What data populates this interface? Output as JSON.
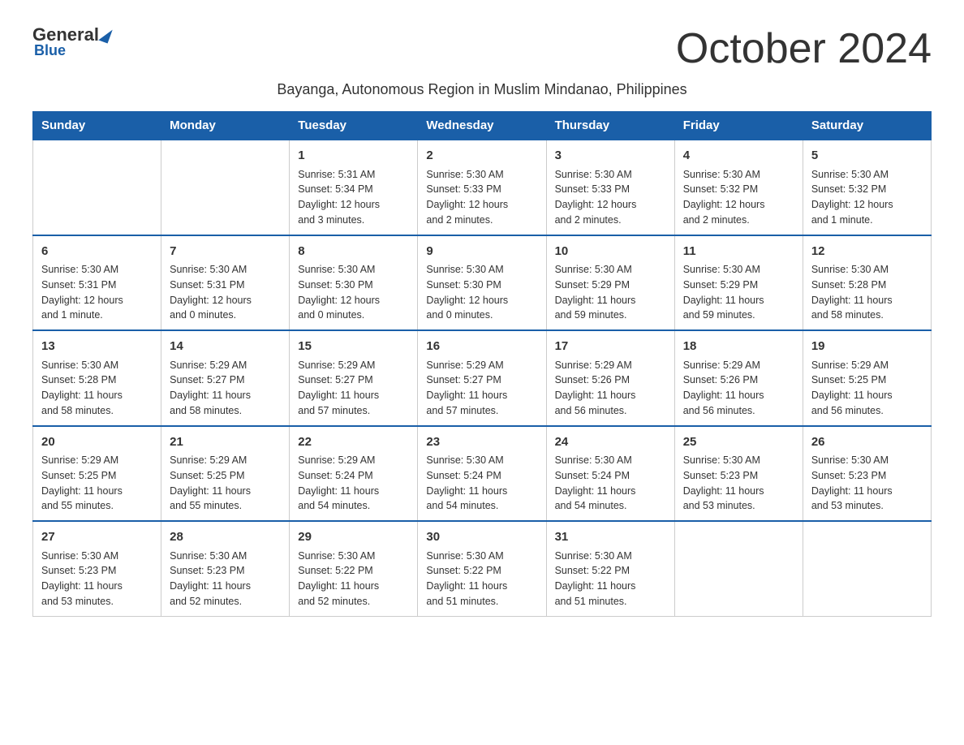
{
  "logo": {
    "general": "General",
    "blue": "Blue"
  },
  "title": "October 2024",
  "subtitle": "Bayanga, Autonomous Region in Muslim Mindanao, Philippines",
  "days_of_week": [
    "Sunday",
    "Monday",
    "Tuesday",
    "Wednesday",
    "Thursday",
    "Friday",
    "Saturday"
  ],
  "weeks": [
    [
      {
        "day": "",
        "info": ""
      },
      {
        "day": "",
        "info": ""
      },
      {
        "day": "1",
        "info": "Sunrise: 5:31 AM\nSunset: 5:34 PM\nDaylight: 12 hours\nand 3 minutes."
      },
      {
        "day": "2",
        "info": "Sunrise: 5:30 AM\nSunset: 5:33 PM\nDaylight: 12 hours\nand 2 minutes."
      },
      {
        "day": "3",
        "info": "Sunrise: 5:30 AM\nSunset: 5:33 PM\nDaylight: 12 hours\nand 2 minutes."
      },
      {
        "day": "4",
        "info": "Sunrise: 5:30 AM\nSunset: 5:32 PM\nDaylight: 12 hours\nand 2 minutes."
      },
      {
        "day": "5",
        "info": "Sunrise: 5:30 AM\nSunset: 5:32 PM\nDaylight: 12 hours\nand 1 minute."
      }
    ],
    [
      {
        "day": "6",
        "info": "Sunrise: 5:30 AM\nSunset: 5:31 PM\nDaylight: 12 hours\nand 1 minute."
      },
      {
        "day": "7",
        "info": "Sunrise: 5:30 AM\nSunset: 5:31 PM\nDaylight: 12 hours\nand 0 minutes."
      },
      {
        "day": "8",
        "info": "Sunrise: 5:30 AM\nSunset: 5:30 PM\nDaylight: 12 hours\nand 0 minutes."
      },
      {
        "day": "9",
        "info": "Sunrise: 5:30 AM\nSunset: 5:30 PM\nDaylight: 12 hours\nand 0 minutes."
      },
      {
        "day": "10",
        "info": "Sunrise: 5:30 AM\nSunset: 5:29 PM\nDaylight: 11 hours\nand 59 minutes."
      },
      {
        "day": "11",
        "info": "Sunrise: 5:30 AM\nSunset: 5:29 PM\nDaylight: 11 hours\nand 59 minutes."
      },
      {
        "day": "12",
        "info": "Sunrise: 5:30 AM\nSunset: 5:28 PM\nDaylight: 11 hours\nand 58 minutes."
      }
    ],
    [
      {
        "day": "13",
        "info": "Sunrise: 5:30 AM\nSunset: 5:28 PM\nDaylight: 11 hours\nand 58 minutes."
      },
      {
        "day": "14",
        "info": "Sunrise: 5:29 AM\nSunset: 5:27 PM\nDaylight: 11 hours\nand 58 minutes."
      },
      {
        "day": "15",
        "info": "Sunrise: 5:29 AM\nSunset: 5:27 PM\nDaylight: 11 hours\nand 57 minutes."
      },
      {
        "day": "16",
        "info": "Sunrise: 5:29 AM\nSunset: 5:27 PM\nDaylight: 11 hours\nand 57 minutes."
      },
      {
        "day": "17",
        "info": "Sunrise: 5:29 AM\nSunset: 5:26 PM\nDaylight: 11 hours\nand 56 minutes."
      },
      {
        "day": "18",
        "info": "Sunrise: 5:29 AM\nSunset: 5:26 PM\nDaylight: 11 hours\nand 56 minutes."
      },
      {
        "day": "19",
        "info": "Sunrise: 5:29 AM\nSunset: 5:25 PM\nDaylight: 11 hours\nand 56 minutes."
      }
    ],
    [
      {
        "day": "20",
        "info": "Sunrise: 5:29 AM\nSunset: 5:25 PM\nDaylight: 11 hours\nand 55 minutes."
      },
      {
        "day": "21",
        "info": "Sunrise: 5:29 AM\nSunset: 5:25 PM\nDaylight: 11 hours\nand 55 minutes."
      },
      {
        "day": "22",
        "info": "Sunrise: 5:29 AM\nSunset: 5:24 PM\nDaylight: 11 hours\nand 54 minutes."
      },
      {
        "day": "23",
        "info": "Sunrise: 5:30 AM\nSunset: 5:24 PM\nDaylight: 11 hours\nand 54 minutes."
      },
      {
        "day": "24",
        "info": "Sunrise: 5:30 AM\nSunset: 5:24 PM\nDaylight: 11 hours\nand 54 minutes."
      },
      {
        "day": "25",
        "info": "Sunrise: 5:30 AM\nSunset: 5:23 PM\nDaylight: 11 hours\nand 53 minutes."
      },
      {
        "day": "26",
        "info": "Sunrise: 5:30 AM\nSunset: 5:23 PM\nDaylight: 11 hours\nand 53 minutes."
      }
    ],
    [
      {
        "day": "27",
        "info": "Sunrise: 5:30 AM\nSunset: 5:23 PM\nDaylight: 11 hours\nand 53 minutes."
      },
      {
        "day": "28",
        "info": "Sunrise: 5:30 AM\nSunset: 5:23 PM\nDaylight: 11 hours\nand 52 minutes."
      },
      {
        "day": "29",
        "info": "Sunrise: 5:30 AM\nSunset: 5:22 PM\nDaylight: 11 hours\nand 52 minutes."
      },
      {
        "day": "30",
        "info": "Sunrise: 5:30 AM\nSunset: 5:22 PM\nDaylight: 11 hours\nand 51 minutes."
      },
      {
        "day": "31",
        "info": "Sunrise: 5:30 AM\nSunset: 5:22 PM\nDaylight: 11 hours\nand 51 minutes."
      },
      {
        "day": "",
        "info": ""
      },
      {
        "day": "",
        "info": ""
      }
    ]
  ],
  "colors": {
    "header_bg": "#1a5fa8",
    "header_text": "#ffffff",
    "border_top": "#1a5fa8"
  }
}
